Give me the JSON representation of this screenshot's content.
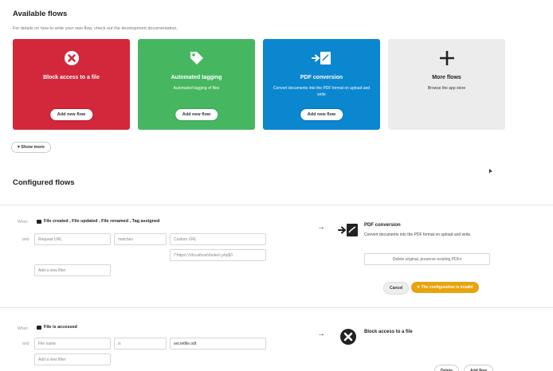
{
  "available": {
    "title": "Available flows",
    "hint": "For details on how to write your own flow, check out the development documentation.",
    "cards": [
      {
        "name": "block",
        "title": "Block access to a file",
        "desc": "",
        "button": "Add new flow",
        "color": "#d3283b",
        "icon": "x-circle-icon"
      },
      {
        "name": "tagging",
        "title": "Automated tagging",
        "desc": "Automated tagging of files",
        "button": "Add new flow",
        "color": "#46b760",
        "icon": "tag-icon"
      },
      {
        "name": "pdf",
        "title": "PDF conversion",
        "desc": "Convert documents into the PDF format on upload and write",
        "button": "Add new flow",
        "color": "#0b87d0",
        "icon": "pdf-icon"
      },
      {
        "name": "more",
        "title": "More flows",
        "desc": "Browse the app store",
        "button": "",
        "color": "#ececec",
        "icon": "plus-icon"
      }
    ],
    "show_more": "▾ Show more"
  },
  "configured": {
    "title": "Configured flows",
    "flows": [
      {
        "when_label": "When",
        "events": "File created , File updated , File renamed , Tag assigned",
        "and_label": "and",
        "filter": {
          "field": "Request URL",
          "operator": "matches",
          "value": "Custom URL",
          "regex": "/^https\\:\\/\\/localhost\\/index\\.php$/i"
        },
        "add_filter": "Add a new filter",
        "operation": {
          "title": "PDF conversion",
          "desc": "Convert documents into the PDF format on upload and write.",
          "select": "Delete original, preserve existing PDFs"
        },
        "cancel": "Cancel",
        "invalid": "✕ The configuration is invalid"
      },
      {
        "when_label": "When",
        "events": "File is accessed",
        "and_label": "and",
        "filter": {
          "field": "File name",
          "operator": "is",
          "value": "secretfile.odt"
        },
        "add_filter": "Add a new filter",
        "operation": {
          "title": "Block access to a file"
        },
        "btn_a": "Delete",
        "btn_b": "Add flow"
      }
    ]
  },
  "arrow": "→"
}
